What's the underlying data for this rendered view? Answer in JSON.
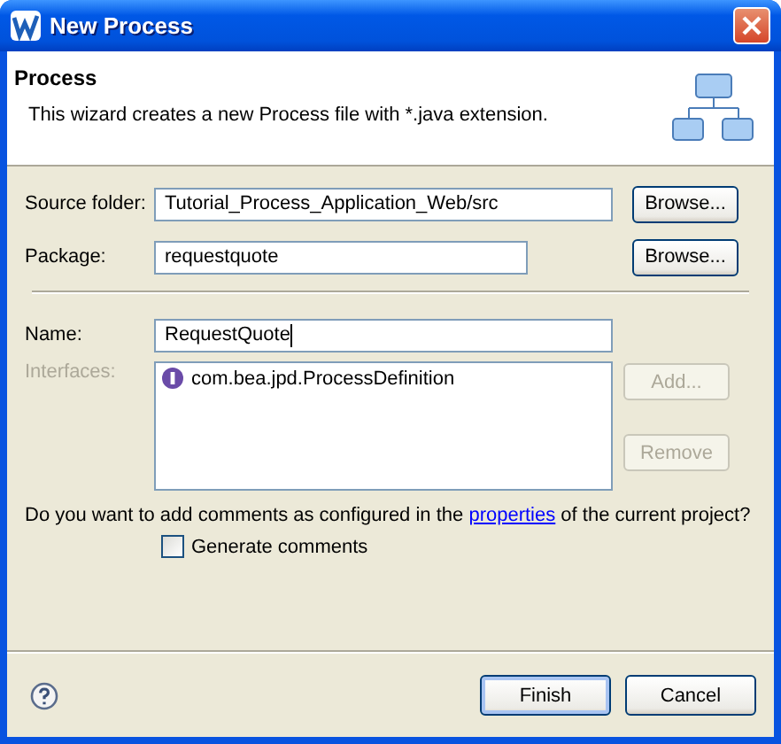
{
  "window": {
    "title": "New Process"
  },
  "header": {
    "title": "Process",
    "description": "This wizard creates a new Process file with *.java extension."
  },
  "location_fields": [
    {
      "label": "Source folder:",
      "value": "Tutorial_Process_Application_Web/src",
      "button": "Browse..."
    },
    {
      "label": "Package:",
      "value": "requestquote",
      "button": "Browse..."
    }
  ],
  "name_field": {
    "label": "Name:",
    "value": "RequestQuote",
    "focused": true
  },
  "interfaces": {
    "label": "Interfaces:",
    "disabled": true,
    "items": [
      {
        "text": "com.bea.jpd.ProcessDefinition"
      }
    ],
    "buttons": [
      {
        "label": "Add...",
        "disabled": true
      },
      {
        "label": "Remove",
        "disabled": true
      }
    ]
  },
  "comments": {
    "question_before": "Do you want to add comments as configured in the ",
    "link": "properties",
    "question_after": " of the current project?",
    "checkbox": {
      "label": "Generate comments",
      "checked": false
    }
  },
  "footer": {
    "buttons": [
      {
        "label": "Finish",
        "default": true
      },
      {
        "label": "Cancel",
        "default": false
      }
    ]
  }
}
